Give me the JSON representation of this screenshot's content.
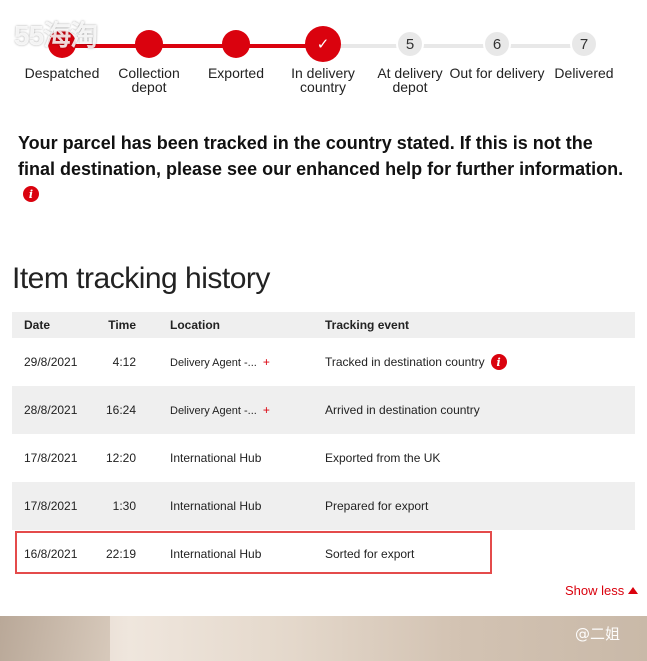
{
  "watermark_top": "55海淘",
  "watermark_bottom": "@二姐",
  "tracker": {
    "steps": [
      {
        "label": "Despatched",
        "state": "done",
        "marker": ""
      },
      {
        "label": "Collection depot",
        "state": "done",
        "marker": ""
      },
      {
        "label": "Exported",
        "state": "done",
        "marker": ""
      },
      {
        "label": "In delivery country",
        "state": "current",
        "marker": "✓"
      },
      {
        "label": "At delivery depot",
        "state": "todo",
        "marker": "5"
      },
      {
        "label": "Out for delivery",
        "state": "todo",
        "marker": "6"
      },
      {
        "label": "Delivered",
        "state": "todo",
        "marker": "7"
      }
    ],
    "active_color": "#da020e",
    "inactive_color": "#e8e8e8"
  },
  "message": "Your parcel has been tracked in the country stated. If this is not the final destination, please see our enhanced help for further information.",
  "history": {
    "title": "Item tracking history",
    "columns": [
      "Date",
      "Time",
      "Location",
      "Tracking event"
    ],
    "rows": [
      {
        "date": "29/8/2021",
        "time": "4:12",
        "location": "Delivery Agent -...",
        "location_expand": "+",
        "event": "Tracked in destination country",
        "event_icon": "info-icon"
      },
      {
        "date": "28/8/2021",
        "time": "16:24",
        "location": "Delivery Agent -...",
        "location_expand": "+",
        "event": "Arrived in destination country"
      },
      {
        "date": "17/8/2021",
        "time": "12:20",
        "location": "International Hub",
        "event": "Exported from the UK"
      },
      {
        "date": "17/8/2021",
        "time": "1:30",
        "location": "International Hub",
        "event": "Prepared for export"
      },
      {
        "date": "16/8/2021",
        "time": "22:19",
        "location": "International Hub",
        "event": "Sorted for export"
      }
    ],
    "show_less": "Show less"
  }
}
